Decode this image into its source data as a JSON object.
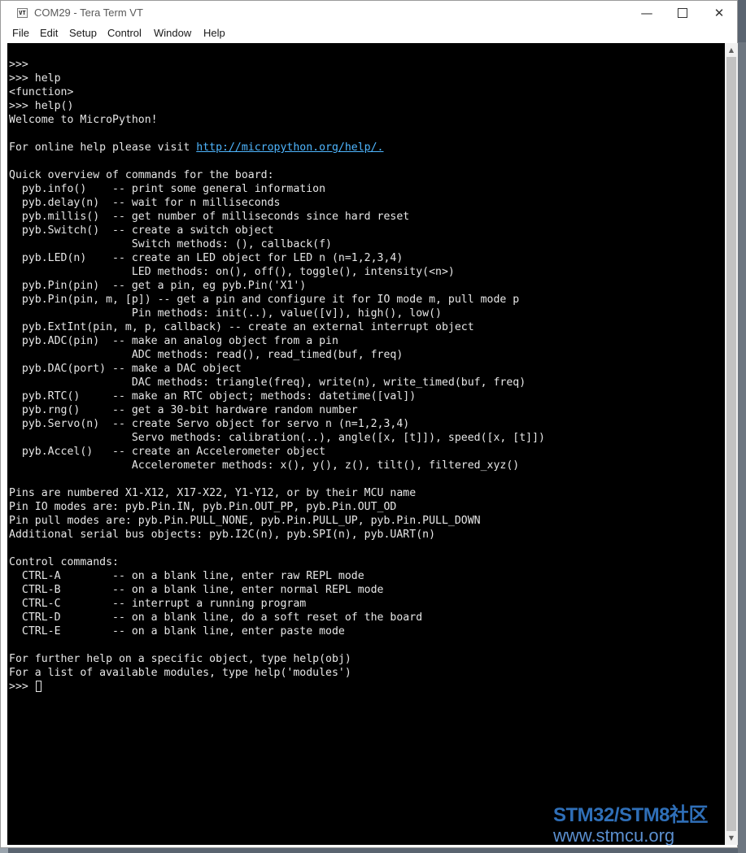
{
  "window": {
    "title": "COM29 - Tera Term VT",
    "icon_label": "VT",
    "controls": {
      "minimize": "—",
      "maximize": "",
      "close": "✕"
    }
  },
  "menu": [
    "File",
    "Edit",
    "Setup",
    "Control",
    "Window",
    "Help"
  ],
  "terminal": {
    "lines": [
      ">>>",
      ">>> help",
      "<function>",
      ">>> help()",
      "Welcome to MicroPython!",
      "",
      "For online help please visit ",
      "",
      "Quick overview of commands for the board:",
      "  pyb.info()    -- print some general information",
      "  pyb.delay(n)  -- wait for n milliseconds",
      "  pyb.millis()  -- get number of milliseconds since hard reset",
      "  pyb.Switch()  -- create a switch object",
      "                   Switch methods: (), callback(f)",
      "  pyb.LED(n)    -- create an LED object for LED n (n=1,2,3,4)",
      "                   LED methods: on(), off(), toggle(), intensity(<n>)",
      "  pyb.Pin(pin)  -- get a pin, eg pyb.Pin('X1')",
      "  pyb.Pin(pin, m, [p]) -- get a pin and configure it for IO mode m, pull mode p",
      "                   Pin methods: init(..), value([v]), high(), low()",
      "  pyb.ExtInt(pin, m, p, callback) -- create an external interrupt object",
      "  pyb.ADC(pin)  -- make an analog object from a pin",
      "                   ADC methods: read(), read_timed(buf, freq)",
      "  pyb.DAC(port) -- make a DAC object",
      "                   DAC methods: triangle(freq), write(n), write_timed(buf, freq)",
      "  pyb.RTC()     -- make an RTC object; methods: datetime([val])",
      "  pyb.rng()     -- get a 30-bit hardware random number",
      "  pyb.Servo(n)  -- create Servo object for servo n (n=1,2,3,4)",
      "                   Servo methods: calibration(..), angle([x, [t]]), speed([x, [t]])",
      "  pyb.Accel()   -- create an Accelerometer object",
      "                   Accelerometer methods: x(), y(), z(), tilt(), filtered_xyz()",
      "",
      "Pins are numbered X1-X12, X17-X22, Y1-Y12, or by their MCU name",
      "Pin IO modes are: pyb.Pin.IN, pyb.Pin.OUT_PP, pyb.Pin.OUT_OD",
      "Pin pull modes are: pyb.Pin.PULL_NONE, pyb.Pin.PULL_UP, pyb.Pin.PULL_DOWN",
      "Additional serial bus objects: pyb.I2C(n), pyb.SPI(n), pyb.UART(n)",
      "",
      "Control commands:",
      "  CTRL-A        -- on a blank line, enter raw REPL mode",
      "  CTRL-B        -- on a blank line, enter normal REPL mode",
      "  CTRL-C        -- interrupt a running program",
      "  CTRL-D        -- on a blank line, do a soft reset of the board",
      "  CTRL-E        -- on a blank line, enter paste mode",
      "",
      "For further help on a specific object, type help(obj)",
      "For a list of available modules, type help('modules')"
    ],
    "help_url": "http://micropython.org/help/.",
    "prompt": ">>> "
  },
  "watermark": {
    "brand": "STM32/STM8社区",
    "url": "www.stmcu.org"
  },
  "colors": {
    "terminal_bg": "#000000",
    "terminal_fg": "#e6e6e6",
    "link": "#4fb6ff",
    "watermark": "#2f6fb8"
  }
}
